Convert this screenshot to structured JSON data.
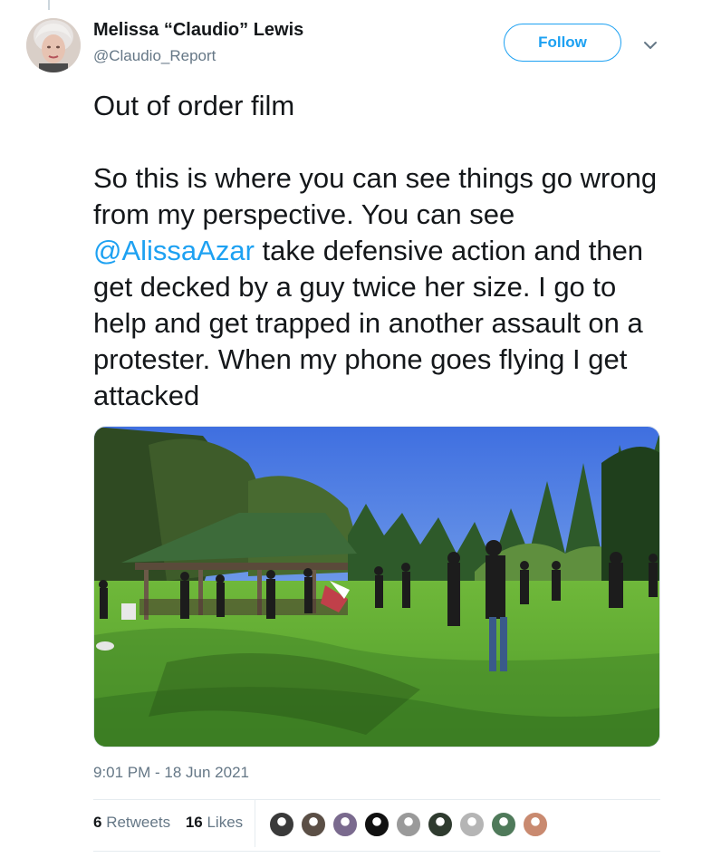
{
  "author": {
    "display_name": "Melissa “Claudio” Lewis",
    "handle": "@Claudio_Report"
  },
  "follow_label": "Follow",
  "tweet": {
    "text_before": "Out of order film\n\nSo this is where you can see things go wrong from my perspective. You can see ",
    "mention": "@AlissaAzar",
    "text_after": " take defensive action and then get decked by a guy twice her size. I go to help and get trapped in another assault on a protester. When my phone goes flying I get attacked"
  },
  "timestamp": "9:01 PM - 18 Jun 2021",
  "stats": {
    "retweets_count": "6",
    "retweets_label": "Retweets",
    "likes_count": "16",
    "likes_label": "Likes"
  },
  "likers": [
    {
      "name": "liker-avatar-1",
      "color": "#3a3a3a"
    },
    {
      "name": "liker-avatar-2",
      "color": "#5b4f46"
    },
    {
      "name": "liker-avatar-3",
      "color": "#7a6a8e"
    },
    {
      "name": "liker-avatar-4",
      "color": "#111111"
    },
    {
      "name": "liker-avatar-5",
      "color": "#9a9a9a"
    },
    {
      "name": "liker-avatar-6",
      "color": "#2f3b2f"
    },
    {
      "name": "liker-avatar-7",
      "color": "#b5b5b5"
    },
    {
      "name": "liker-avatar-8",
      "color": "#4f7a5a"
    },
    {
      "name": "liker-avatar-9",
      "color": "#c98a70"
    }
  ],
  "colors": {
    "accent": "#1da1f2",
    "text": "#14171a",
    "muted": "#657786"
  }
}
